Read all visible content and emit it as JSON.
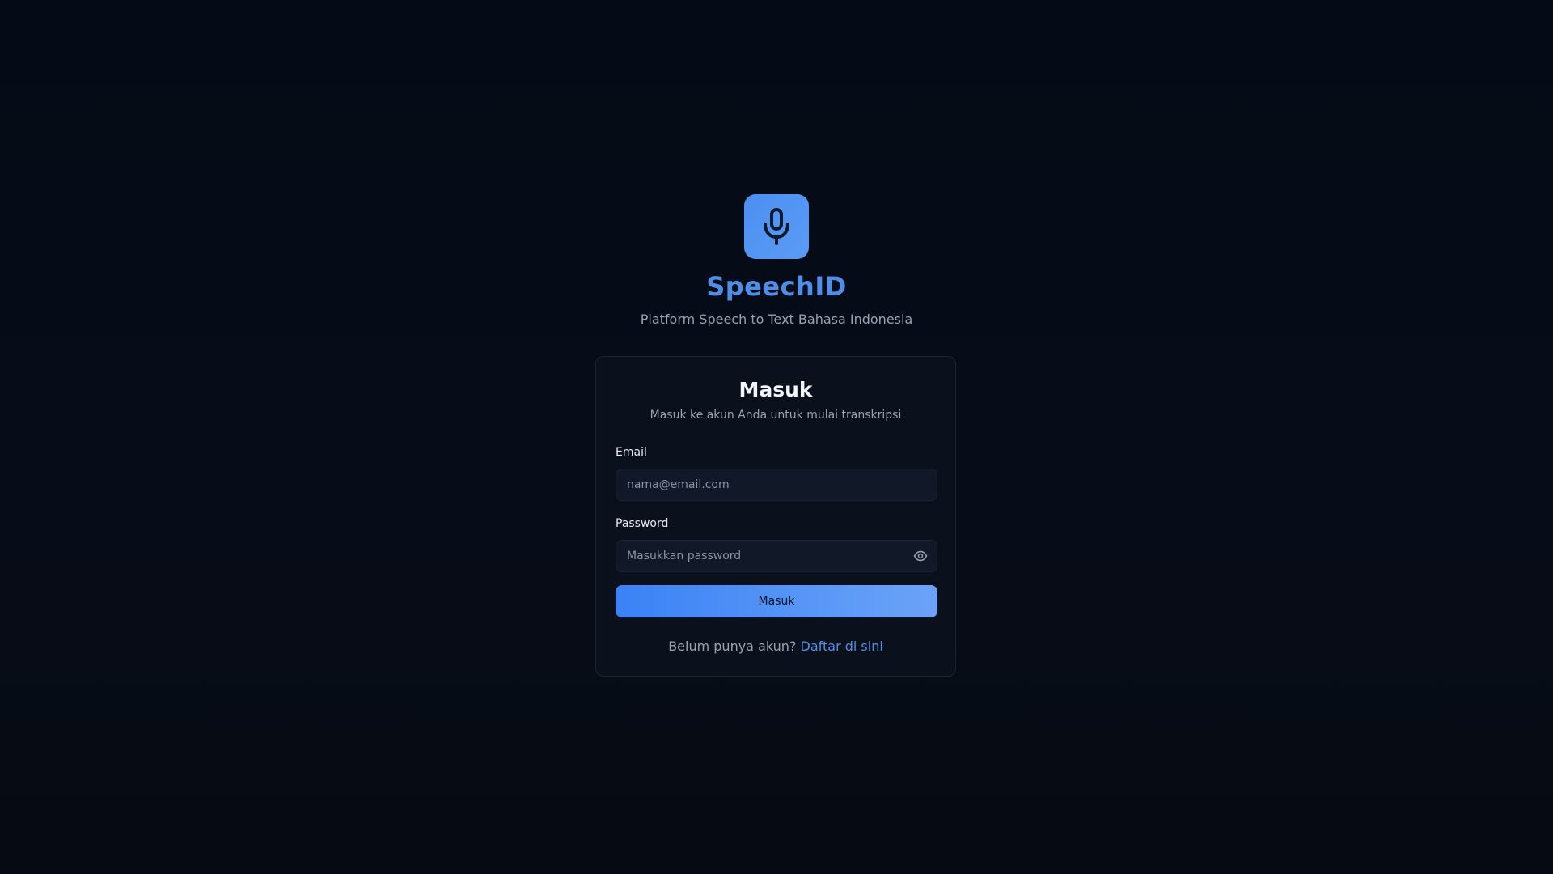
{
  "brand": {
    "logo_icon": "microphone-icon",
    "name": "SpeechID",
    "tagline": "Platform Speech to Text Bahasa Indonesia",
    "accent_color": "#4f8ee6"
  },
  "login": {
    "title": "Masuk",
    "subtitle": "Masuk ke akun Anda untuk mulai transkripsi",
    "email": {
      "label": "Email",
      "placeholder": "nama@email.com",
      "value": ""
    },
    "password": {
      "label": "Password",
      "placeholder": "Masukkan password",
      "value": "",
      "toggle_icon": "eye-icon"
    },
    "submit_label": "Masuk",
    "register_prompt": "Belum punya akun?",
    "register_link": "Daftar di sini"
  },
  "colors": {
    "background": "#060b14",
    "card": "#0b111c",
    "button_gradient_start": "#3b82f6",
    "button_gradient_end": "#6ba3f7"
  }
}
